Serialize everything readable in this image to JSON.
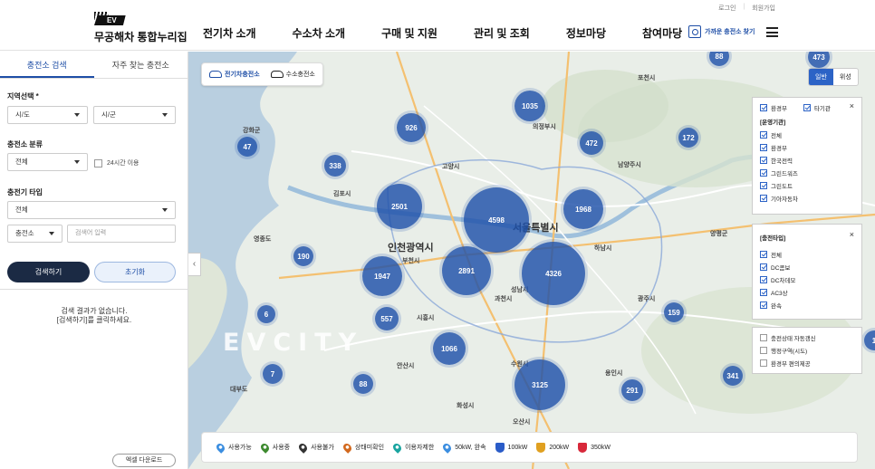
{
  "header": {
    "util_links": [
      "로그인",
      "회원가입"
    ],
    "logo_badge": "EV",
    "logo_title": "무공해차 통합누리집",
    "nav": [
      "전기차 소개",
      "수소차 소개",
      "구매 및 지원",
      "관리 및 조회",
      "정보마당",
      "참여마당"
    ],
    "finder_label": "가까운 충전소 찾기"
  },
  "panel": {
    "tabs": [
      "충전소 검색",
      "자주 찾는 충전소"
    ],
    "region_label": "지역선택 *",
    "region_sido": "시/도",
    "region_sigun": "시/군",
    "category_label": "충전소 분류",
    "category_value": "전체",
    "hours_label": "24시간 이용",
    "charger_type_label": "충전기 타입",
    "charger_type_value": "전체",
    "search_scope": "충전소",
    "search_placeholder": "검색어 입력",
    "search_button": "검색하기",
    "reset_button": "초기화",
    "empty_line1": "검색 결과가 없습니다.",
    "empty_line2": "[검색하기]를 클릭하세요.",
    "excel_button": "엑셀 다운로드"
  },
  "map": {
    "type_tabs": [
      "전기차충전소",
      "수소충전소"
    ],
    "view_toggle": [
      "일반",
      "위성"
    ],
    "watermark": "EVCITY",
    "clusters": [
      {
        "count": "88"
      },
      {
        "count": "473"
      },
      {
        "count": "1035"
      },
      {
        "count": "926"
      },
      {
        "count": "472"
      },
      {
        "count": "172"
      },
      {
        "count": "47"
      },
      {
        "count": "338"
      },
      {
        "count": "2501"
      },
      {
        "count": "4598"
      },
      {
        "count": "1968"
      },
      {
        "count": "190"
      },
      {
        "count": "1947"
      },
      {
        "count": "2891"
      },
      {
        "count": "4326"
      },
      {
        "count": "557"
      },
      {
        "count": "6"
      },
      {
        "count": "159"
      },
      {
        "count": "1066"
      },
      {
        "count": "7"
      },
      {
        "count": "88"
      },
      {
        "count": "3125"
      },
      {
        "count": "291"
      },
      {
        "count": "341"
      },
      {
        "count": "1"
      }
    ],
    "places": [
      "인천광역시",
      "서울특별시",
      "의정부시",
      "남양주시",
      "하남시",
      "광주시",
      "시흥시",
      "안산시",
      "김포시",
      "부천시",
      "고양시",
      "과천시",
      "용인시",
      "수원시",
      "성남시",
      "화성시",
      "오산시",
      "양평군",
      "포천시",
      "강화군",
      "영종도",
      "대부도"
    ],
    "operator_panel": {
      "top_checks": [
        "환경부",
        "타기관"
      ],
      "heading": "[운영기관]",
      "items": [
        "전체",
        "환경부",
        "한국전력",
        "그린드워즈",
        "그린도트",
        "기아자동차"
      ]
    },
    "charger_panel": {
      "heading": "[충전타입]",
      "items": [
        "전체",
        "DC콤보",
        "DC차데모",
        "AC3상",
        "완속"
      ]
    },
    "option_panel": {
      "items": [
        "충전상태 자동갱신",
        "행정구역(시도)",
        "환경부 편의제공"
      ]
    },
    "legend": [
      {
        "label": "사용가능",
        "color": "#3b8ee0"
      },
      {
        "label": "사용중",
        "color": "#3d8a2f"
      },
      {
        "label": "사용불가",
        "color": "#333333"
      },
      {
        "label": "상태미확인",
        "color": "#d2691e"
      },
      {
        "label": "이용자제한",
        "color": "#19a4a0"
      },
      {
        "label": "50kW, 완속",
        "color": "#3b8ee0"
      },
      {
        "label": "100kW",
        "color": "#2a5cc8"
      },
      {
        "label": "200kW",
        "color": "#e0a020"
      },
      {
        "label": "350kW",
        "color": "#d8283a"
      }
    ]
  }
}
